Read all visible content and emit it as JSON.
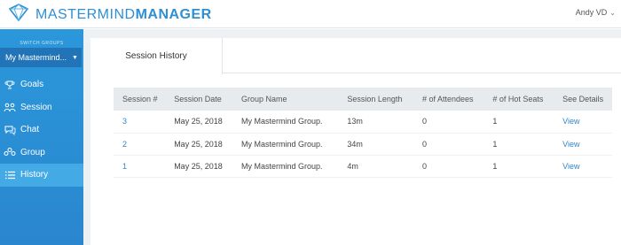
{
  "brand": {
    "name_light": "MASTERMIND",
    "name_bold": "MANAGER",
    "logo_icon": "brain-diamond-icon",
    "color": "#2f8fd3"
  },
  "user": {
    "name": "Andy VD"
  },
  "sidebar": {
    "switch_label": "SWITCH GROUPS",
    "selected_group": "My Mastermind...",
    "items": [
      {
        "label": "Goals",
        "icon": "goals-icon",
        "active": false
      },
      {
        "label": "Session",
        "icon": "session-icon",
        "active": false
      },
      {
        "label": "Chat",
        "icon": "chat-icon",
        "active": false
      },
      {
        "label": "Group",
        "icon": "group-icon",
        "active": false
      },
      {
        "label": "History",
        "icon": "history-icon",
        "active": true
      }
    ],
    "colors": {
      "background": "#2a8fd6",
      "active": "#44aae6",
      "select": "#2274b8"
    }
  },
  "tabs": [
    {
      "label": "Session History",
      "active": true
    }
  ],
  "table": {
    "columns": [
      "Session #",
      "Session Date",
      "Group Name",
      "Session Length",
      "# of Attendees",
      "# of Hot Seats",
      "See Details"
    ],
    "rows": [
      {
        "session": "3",
        "date": "May 25, 2018",
        "group": "My Mastermind Group.",
        "length": "13m",
        "attendees": "0",
        "hot_seats": "1",
        "details": "View"
      },
      {
        "session": "2",
        "date": "May 25, 2018",
        "group": "My Mastermind Group.",
        "length": "34m",
        "attendees": "0",
        "hot_seats": "1",
        "details": "View"
      },
      {
        "session": "1",
        "date": "May 25, 2018",
        "group": "My Mastermind Group.",
        "length": "4m",
        "attendees": "0",
        "hot_seats": "1",
        "details": "View"
      }
    ]
  }
}
